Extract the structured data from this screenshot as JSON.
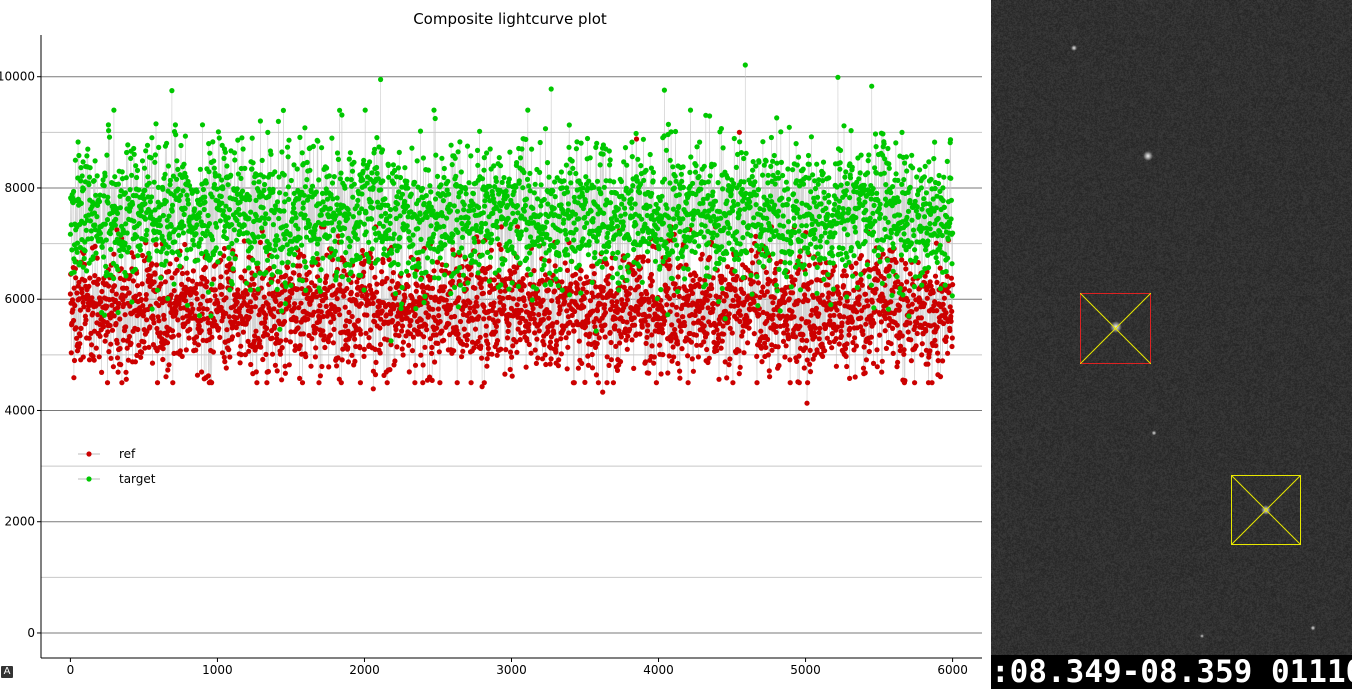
{
  "chart_data": {
    "type": "scatter",
    "title": "Composite lightcurve plot",
    "xlabel": "",
    "ylabel": "",
    "xlim": [
      -200,
      6200
    ],
    "ylim": [
      -450,
      10750
    ],
    "x_ticks": [
      0,
      1000,
      2000,
      3000,
      4000,
      5000,
      6000
    ],
    "y_ticks": [
      0,
      2000,
      4000,
      6000,
      8000,
      10000
    ],
    "grid": "horizontal",
    "legend_position": "left-middle",
    "x_range_points": [
      0,
      6000
    ],
    "series": [
      {
        "name": "ref",
        "color": "#cc0000",
        "typical_range": [
          4500,
          7000
        ],
        "mean": 5800,
        "sample_extremes": [
          {
            "x": 2060,
            "y": 4390
          },
          {
            "x": 3620,
            "y": 4330
          },
          {
            "x": 5010,
            "y": 4130
          },
          {
            "x": 2800,
            "y": 4430
          },
          {
            "x": 4550,
            "y": 9000
          },
          {
            "x": 3850,
            "y": 8880
          }
        ]
      },
      {
        "name": "target",
        "color": "#00c800",
        "typical_range": [
          5500,
          9000
        ],
        "mean": 7500,
        "sample_extremes": [
          {
            "x": 4590,
            "y": 10210
          },
          {
            "x": 5220,
            "y": 9990
          },
          {
            "x": 2110,
            "y": 9950
          },
          {
            "x": 5450,
            "y": 9830
          },
          {
            "x": 3270,
            "y": 9780
          },
          {
            "x": 690,
            "y": 9750
          },
          {
            "x": 4040,
            "y": 9760
          }
        ]
      }
    ]
  },
  "legend": {
    "ref_label": "ref",
    "target_label": "target"
  },
  "image_panel": {
    "timestamp": ":08.349-08.359 01110",
    "ref_aperture_color": "#dd2222",
    "target_aperture_color": "#e8e800"
  },
  "toolbar": {
    "autoscale_label": "A"
  }
}
